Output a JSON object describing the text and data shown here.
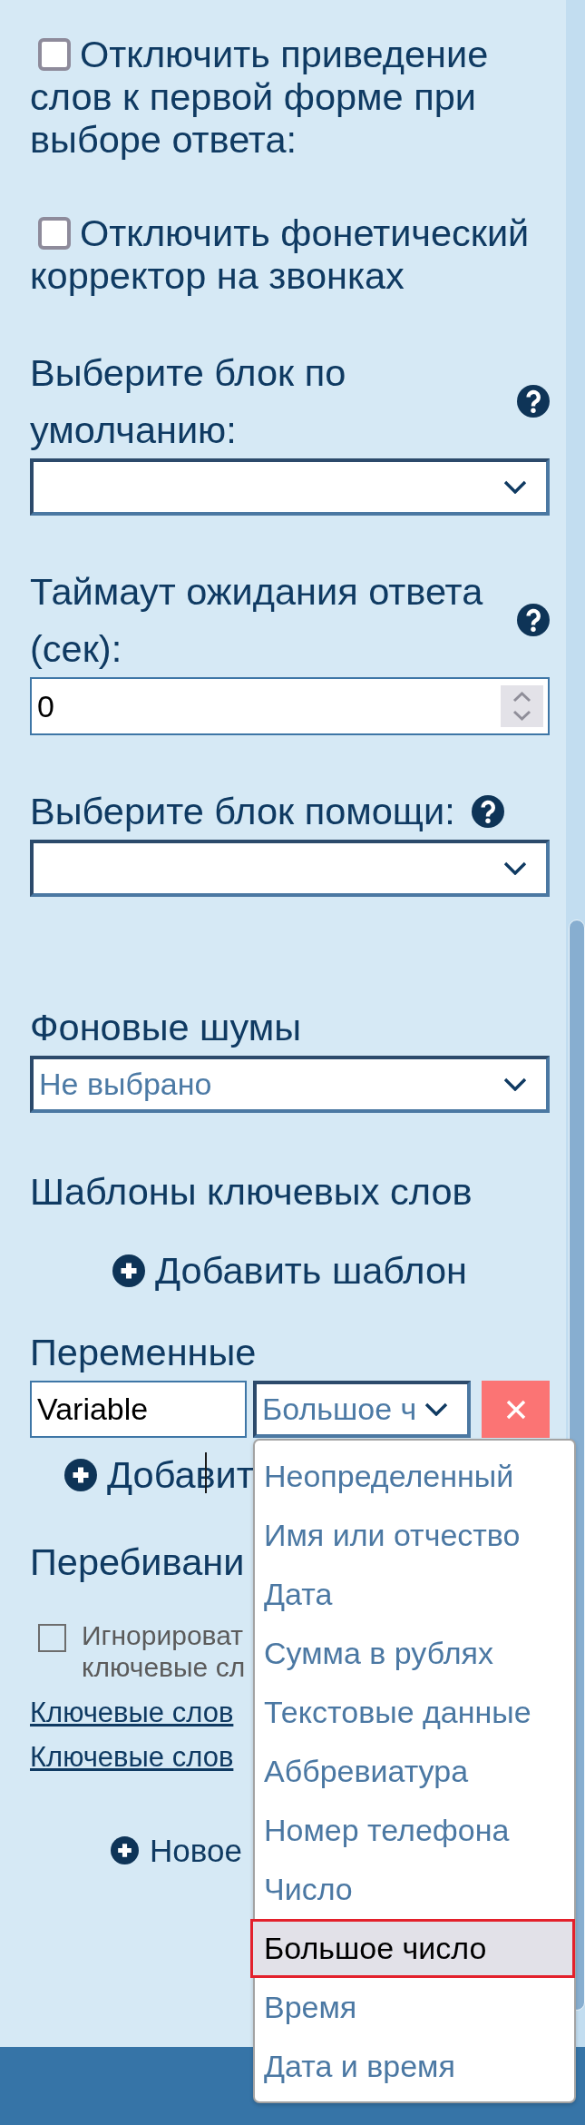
{
  "options": [
    {
      "kind": "checkbox",
      "label": "Отключить приведение слов к первой форме при выборе ответа:",
      "checked": false
    },
    {
      "kind": "checkbox",
      "label": "Отключить фонетический корректор на звонках",
      "checked": false
    }
  ],
  "settings": [
    {
      "kind": "select",
      "label": "Выберите блок по умолчанию:",
      "help": true
    },
    {
      "kind": "number",
      "label": "Таймаут ожидания ответа (сек):",
      "help": true,
      "value": "0"
    },
    {
      "kind": "select",
      "label": "Выберите блок помощи:",
      "help": true
    }
  ],
  "background_noise": {
    "label": "Фоновые шумы",
    "value": "Не выбрано"
  },
  "keyword_templates": {
    "title": "Шаблоны ключевых слов",
    "add_button": "Добавить шаблон"
  },
  "variables": {
    "title": "Переменные",
    "rows": [
      {
        "name": "Variable",
        "type": "Большое ч",
        "open": true
      }
    ],
    "add_button": "Добавит",
    "type_options": [
      {
        "label": "Неопределенный",
        "selected": false
      },
      {
        "label": "Имя или отчество",
        "selected": false
      },
      {
        "label": "Дата",
        "selected": false
      },
      {
        "label": "Сумма в рублях",
        "selected": false
      },
      {
        "label": "Текстовые данные",
        "selected": false
      },
      {
        "label": "Аббревиатура",
        "selected": false
      },
      {
        "label": "Номер телефона",
        "selected": false
      },
      {
        "label": "Число",
        "selected": false
      },
      {
        "label": "Большое число",
        "selected": true
      },
      {
        "label": "Время",
        "selected": false
      },
      {
        "label": "Дата и время",
        "selected": false
      }
    ]
  },
  "interruptions": {
    "title": "Перебивани",
    "ignore_option": {
      "label": "Игнорироват ключевые сл",
      "checked": false
    },
    "links": [
      "Ключевые слов",
      "Ключевые слов"
    ],
    "new_button": "Новое"
  }
}
